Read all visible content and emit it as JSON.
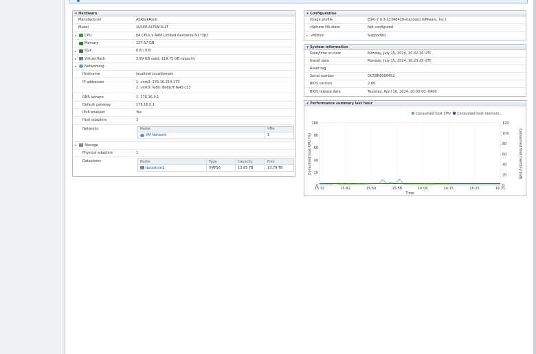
{
  "hardware": {
    "title": "Hardware",
    "rows": [
      {
        "key": "Manufacturer",
        "value": "ASRockRack"
      },
      {
        "key": "Model",
        "value": "1U16E-ALTRA/1L2T"
      },
      {
        "key": "CPU",
        "value": "64 CPUs x ARM Limited Neoverse N1 r3p1"
      },
      {
        "key": "Memory",
        "value": "127.57 GB"
      },
      {
        "key": "SGX",
        "value": "0 B / 0 B"
      },
      {
        "key": "Virtual flash",
        "value": "3.89 GB used, 119.75 GB capacity"
      },
      {
        "key": "Networking",
        "value": ""
      }
    ],
    "networking": {
      "hostname_key": "Hostname",
      "hostname": "localhost.localdomain",
      "ip_key": "IP addresses",
      "ip1": "1. vmk0: 176.16.254.173",
      "ip2": "2. vmk0: fe80::8e6b:ff:fe43:c13",
      "dns_key": "DNS servers",
      "dns": "1. 176.16.0.1",
      "gw_key": "Default gateway",
      "gw": "176.16.0.1",
      "ipv6_key": "IPv6 enabled",
      "ipv6": "Yes",
      "adapters_key": "Host adapters",
      "adapters": "3",
      "networks_key": "Networks",
      "net_col_name": "Name",
      "net_col_vms": "VMs",
      "net_name": "VM Network",
      "net_vms": "1"
    },
    "storage": {
      "label": "Storage",
      "adapters_key": "Physical adapters",
      "adapters": "1",
      "ds_key": "Datastores",
      "col_name": "Name",
      "col_type": "Type",
      "col_cap": "Capacity",
      "col_free": "Free",
      "ds_name": "datastore1",
      "ds_type": "VMFS6",
      "ds_cap": "13.85 TB",
      "ds_free": "13.79 TB"
    }
  },
  "configuration": {
    "title": "Configuration",
    "rows": [
      {
        "key": "Image profile",
        "value": "ESXi-7.0.3-22348429-standard (VMware, Inc.)"
      },
      {
        "key": "vSphere HA state",
        "value": "Not configured"
      },
      {
        "key": "vMotion",
        "value": "Supported"
      }
    ]
  },
  "system": {
    "title": "System information",
    "rows": [
      {
        "key": "Date/time on host",
        "value": "Monday, July 15, 2024, 20:32:10 UTC"
      },
      {
        "key": "Install date",
        "value": "Monday, July 15, 2024, 16:23:25 UTC"
      },
      {
        "key": "Asset tag",
        "value": ""
      },
      {
        "key": "Serial number",
        "value": "GCS9R8000452"
      },
      {
        "key": "BIOS version",
        "value": "2.06"
      },
      {
        "key": "BIOS release date",
        "value": "Tuesday, April 16, 2024, 20:00:00 -0400"
      }
    ]
  },
  "performance": {
    "title": "Performance summary last hour"
  },
  "colors": {
    "cpu": "#5cb85c",
    "memory": "#1f4e8c"
  },
  "chart_data": {
    "type": "line",
    "xlabel": "Time",
    "ylabel": "Consumed host CPU (%)",
    "y2label": "Consumed host memory (GB)",
    "x": [
      "15:32",
      "15:41",
      "15:50",
      "15:58",
      "16:06",
      "16:15",
      "16:23",
      "16:31"
    ],
    "ylim": [
      0,
      100
    ],
    "yticks": [
      0,
      20,
      40,
      60,
      80,
      100
    ],
    "y2lim": [
      0,
      120
    ],
    "y2ticks": [
      0,
      20,
      40,
      60,
      80,
      100,
      120
    ],
    "grid": true,
    "legend": "top-right",
    "series": [
      {
        "name": "Consumed host CPU",
        "axis": "left",
        "points": [
          [
            0,
            1
          ],
          [
            0.4,
            1
          ],
          [
            0.6,
            3
          ],
          [
            0.8,
            1
          ],
          [
            1.2,
            2
          ],
          [
            1.5,
            1
          ],
          [
            1.8,
            2
          ],
          [
            2.3,
            3
          ],
          [
            2.45,
            9
          ],
          [
            2.6,
            2
          ],
          [
            2.8,
            5
          ],
          [
            2.95,
            2
          ],
          [
            3.1,
            10
          ],
          [
            3.25,
            2
          ],
          [
            3.5,
            1
          ],
          [
            4,
            1
          ],
          [
            4.5,
            2
          ],
          [
            5,
            1
          ],
          [
            5.5,
            1
          ],
          [
            6,
            1
          ],
          [
            6.5,
            1
          ],
          [
            7,
            1
          ]
        ]
      },
      {
        "name": "Consumed host memory...",
        "axis": "right",
        "points": [
          [
            0,
            3.2
          ],
          [
            1,
            3.2
          ],
          [
            2,
            3.3
          ],
          [
            3,
            3.4
          ],
          [
            4,
            3.4
          ],
          [
            5,
            3.4
          ],
          [
            6,
            3.4
          ],
          [
            7,
            3.4
          ]
        ]
      }
    ]
  }
}
